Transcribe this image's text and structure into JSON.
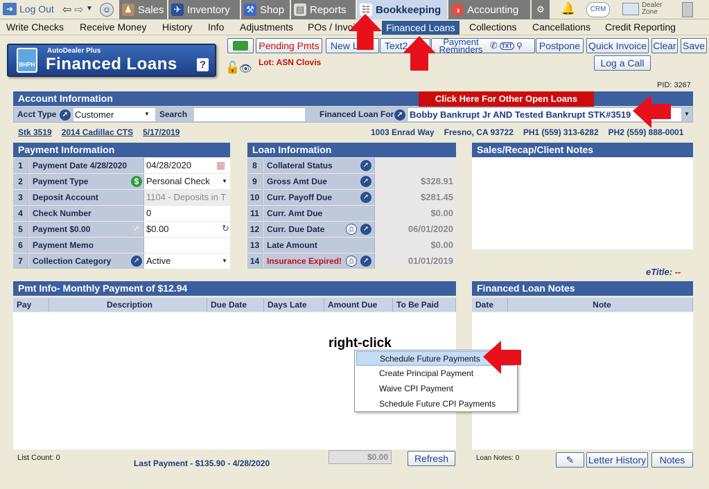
{
  "nav": {
    "logout": "Log Out",
    "tabs": [
      {
        "label": "Sales"
      },
      {
        "label": "Inventory"
      },
      {
        "label": "Shop"
      },
      {
        "label": "Reports"
      },
      {
        "label": "Bookkeeping"
      },
      {
        "label": "Accounting"
      }
    ],
    "crm": "CRM",
    "dealer_zone": "Dealer Zone"
  },
  "submenu": [
    "Write Checks",
    "Receive Money",
    "History",
    "Info",
    "Adjustments",
    "POs / Invoi",
    "Financed Loans",
    "Collections",
    "Cancellations",
    "Credit Reporting"
  ],
  "toolbar": {
    "pending": "Pending Pmts",
    "newl": "New L",
    "text": "Text2",
    "payment_reminders": "Payment Reminders",
    "txt_icon": "TXT",
    "postpone": "Postpone",
    "quick_invoice": "Quick Invoice",
    "clear": "Clear",
    "save": "Save",
    "log_call": "Log a Call"
  },
  "logo": {
    "small": "AutoDealer Plus",
    "big": "Financed Loans",
    "help": "?",
    "badge": "BHPH"
  },
  "lot": "Lot: ASN Clovis",
  "pid": "PID: 3267",
  "account": {
    "title": "Account Information",
    "other_loans": "Click Here For Other Open Loans",
    "acct_type_label": "Acct Type",
    "acct_type_value": "Customer",
    "search_label": "Search",
    "search_value": "",
    "fin_loan_for_label": "Financed Loan For",
    "fin_loan_for_value": "Bobby Bankrupt Jr AND Tested Bankrupt  STK#3519"
  },
  "vehicle": {
    "stk": "Stk 3519",
    "car": "2014 Cadillac CTS",
    "date": "5/17/2019"
  },
  "address": {
    "street": "1003 Enrad Way",
    "city": "Fresno, CA 93722",
    "ph1": "PH1 (559) 313-6282",
    "ph2": "PH2 (559) 888-0001"
  },
  "payment_info": {
    "title": "Payment Information",
    "rows": [
      {
        "n": "1",
        "label": "Payment Date  4/28/2020",
        "value": "04/28/2020"
      },
      {
        "n": "2",
        "label": "Payment Type",
        "value": "Personal Check"
      },
      {
        "n": "3",
        "label": "Deposit Account",
        "value": "1104 - Deposits in T"
      },
      {
        "n": "4",
        "label": "Check Number",
        "value": "0"
      },
      {
        "n": "5",
        "label": "Payment  $0.00",
        "value": "$0.00"
      },
      {
        "n": "6",
        "label": "Payment Memo",
        "value": ""
      },
      {
        "n": "7",
        "label": "Collection Category",
        "value": "Active"
      }
    ]
  },
  "loan_info": {
    "title": "Loan Information",
    "rows": [
      {
        "n": "8",
        "label": "Collateral Status",
        "value": ""
      },
      {
        "n": "9",
        "label": "Gross Amt Due",
        "value": "$328.91"
      },
      {
        "n": "10",
        "label": "Curr. Payoff Due",
        "value": "$281.45"
      },
      {
        "n": "11",
        "label": "Curr. Amt Due",
        "value": "$0.00"
      },
      {
        "n": "12",
        "label": "Curr. Due Date",
        "value": "06/01/2020"
      },
      {
        "n": "13",
        "label": "Late Amount",
        "value": "$0.00"
      },
      {
        "n": "14",
        "label": "Insurance Expired!",
        "value": "01/01/2019"
      }
    ]
  },
  "notes_panel": {
    "title": "Sales/Recap/Client Notes"
  },
  "etitle": {
    "label": "eTitle:",
    "value": "--"
  },
  "pmt": {
    "title": "Pmt Info- Monthly Payment of $12.94",
    "columns": [
      "Pay",
      "Description",
      "Due Date",
      "Days Late",
      "Amount Due",
      "To Be Paid"
    ],
    "list_count": "List Count:  0",
    "last_payment": "Last Payment - $135.90 - 4/28/2020",
    "total": "$0.00",
    "refresh": "Refresh"
  },
  "loan_notes": {
    "title": "Financed Loan Notes",
    "columns": [
      "Date",
      "Note"
    ],
    "count": "Loan Notes:  0",
    "letter_history": "Letter History",
    "notes": "Notes"
  },
  "annotation": "right-click",
  "context_menu": [
    "Schedule Future Payments",
    "Create Principal Payment",
    "Waive CPI Payment",
    "Schedule Future CPI Payments"
  ],
  "colors": {
    "header": "#3b5f9f",
    "arrow": "#e8101a",
    "active_sub": "#2f5b9a"
  }
}
